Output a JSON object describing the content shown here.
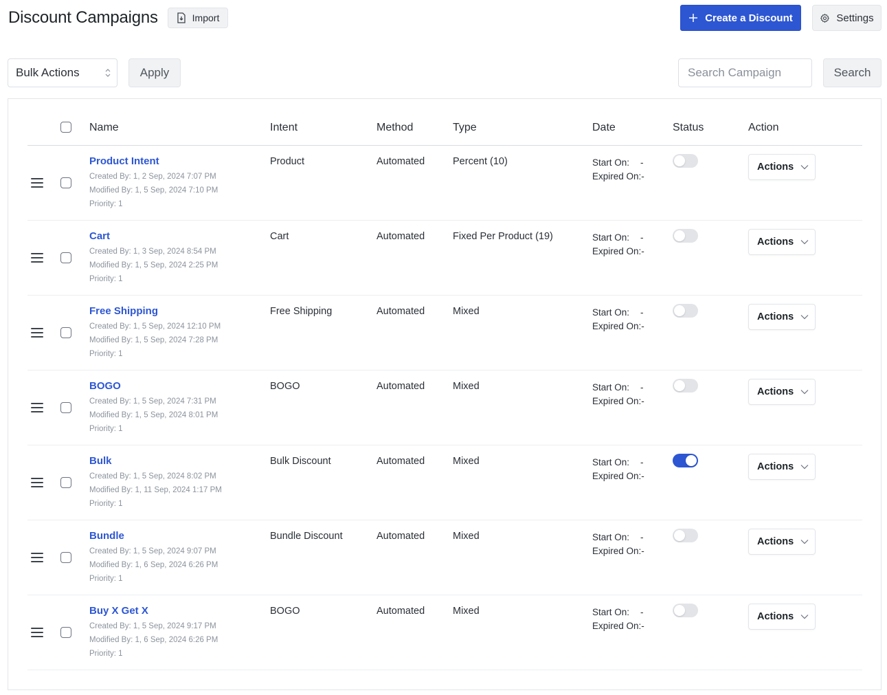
{
  "header": {
    "title": "Discount Campaigns",
    "import_label": "Import",
    "create_label": "Create a Discount",
    "settings_label": "Settings"
  },
  "toolbar": {
    "bulk_actions_value": "Bulk Actions",
    "apply_label": "Apply",
    "search_placeholder": "Search Campaign",
    "search_label": "Search"
  },
  "table": {
    "columns": {
      "name": "Name",
      "intent": "Intent",
      "method": "Method",
      "type": "Type",
      "date": "Date",
      "status": "Status",
      "action": "Action"
    },
    "date_labels": {
      "start": "Start On:",
      "expired": "Expired On:"
    },
    "action_label": "Actions",
    "rows": [
      {
        "name": "Product Intent",
        "created": "Created By: 1, 2 Sep, 2024 7:07 PM",
        "modified": "Modified By: 1, 5 Sep, 2024 7:10 PM",
        "priority": "Priority: 1",
        "intent": "Product",
        "method": "Automated",
        "type": "Percent (10)",
        "start": "-",
        "expired": "-",
        "status": false
      },
      {
        "name": "Cart",
        "created": "Created By: 1, 3 Sep, 2024 8:54 PM",
        "modified": "Modified By: 1, 5 Sep, 2024 2:25 PM",
        "priority": "Priority: 1",
        "intent": "Cart",
        "method": "Automated",
        "type": "Fixed Per Product (19)",
        "start": "-",
        "expired": "-",
        "status": false
      },
      {
        "name": "Free Shipping",
        "created": "Created By: 1, 5 Sep, 2024 12:10 PM",
        "modified": "Modified By: 1, 5 Sep, 2024 7:28 PM",
        "priority": "Priority: 1",
        "intent": "Free Shipping",
        "method": "Automated",
        "type": "Mixed",
        "start": "-",
        "expired": "-",
        "status": false
      },
      {
        "name": "BOGO",
        "created": "Created By: 1, 5 Sep, 2024 7:31 PM",
        "modified": "Modified By: 1, 5 Sep, 2024 8:01 PM",
        "priority": "Priority: 1",
        "intent": "BOGO",
        "method": "Automated",
        "type": "Mixed",
        "start": "-",
        "expired": "-",
        "status": false
      },
      {
        "name": "Bulk",
        "created": "Created By: 1, 5 Sep, 2024 8:02 PM",
        "modified": "Modified By: 1, 11 Sep, 2024 1:17 PM",
        "priority": "Priority: 1",
        "intent": "Bulk Discount",
        "method": "Automated",
        "type": "Mixed",
        "start": "-",
        "expired": "-",
        "status": true
      },
      {
        "name": "Bundle",
        "created": "Created By: 1, 5 Sep, 2024 9:07 PM",
        "modified": "Modified By: 1, 6 Sep, 2024 6:26 PM",
        "priority": "Priority: 1",
        "intent": "Bundle Discount",
        "method": "Automated",
        "type": "Mixed",
        "start": "-",
        "expired": "-",
        "status": false
      },
      {
        "name": "Buy X Get X",
        "created": "Created By: 1, 5 Sep, 2024 9:17 PM",
        "modified": "Modified By: 1, 6 Sep, 2024 6:26 PM",
        "priority": "Priority: 1",
        "intent": "BOGO",
        "method": "Automated",
        "type": "Mixed",
        "start": "-",
        "expired": "-",
        "status": false
      }
    ]
  },
  "colors": {
    "accent": "#2d56d3",
    "toggle_off": "#e2e4e8",
    "meta_text": "#8c939c"
  }
}
